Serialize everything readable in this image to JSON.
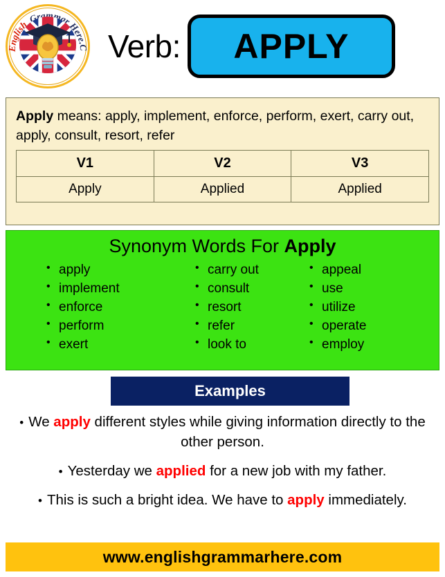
{
  "logo": {
    "alt": "English Grammar Here.Com badge",
    "text_red": "English",
    "text_navy": "Grammar Here.Com",
    "ring_color": "#F5B721",
    "red_color": "#D81E05",
    "navy_color": "#1F2B5B"
  },
  "header": {
    "verb_label": "Verb:",
    "verb_word": "APPLY",
    "box_color": "#18B2ED"
  },
  "definition": {
    "headword": "Apply",
    "means_text": " means: apply, implement, enforce, perform, exert, carry out, apply, consult, resort, refer",
    "panel_color": "#FAF0CD"
  },
  "verb_table": {
    "headers": [
      "V1",
      "V2",
      "V3"
    ],
    "row": [
      "Apply",
      "Applied",
      "Applied"
    ]
  },
  "synonyms": {
    "title_prefix": "Synonym Words For ",
    "title_word": "Apply",
    "panel_color": "#3CE312",
    "columns": [
      [
        "apply",
        "implement",
        "enforce",
        "perform",
        "exert"
      ],
      [
        "carry out",
        "consult",
        "resort",
        "refer",
        "look to"
      ],
      [
        "appeal",
        "use",
        "utilize",
        "operate",
        "employ"
      ]
    ]
  },
  "examples": {
    "banner_label": "Examples",
    "banner_color": "#0A2163",
    "highlight_color": "#FF0000",
    "items": [
      {
        "pre": "We ",
        "hl": "apply",
        "post": " different styles while giving information directly to the other person."
      },
      {
        "pre": "Yesterday we ",
        "hl": "applied",
        "post": " for a new job with my father."
      },
      {
        "pre": "This is such a bright idea. We have to ",
        "hl": "apply",
        "post": " immediately."
      }
    ]
  },
  "footer": {
    "url": "www.englishgrammarhere.com",
    "bar_color": "#FFC20E"
  }
}
